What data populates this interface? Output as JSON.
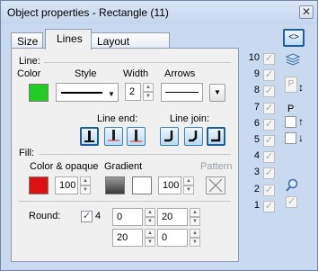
{
  "window": {
    "title": "Object properties - Rectangle (11)",
    "close_label": "✕"
  },
  "tabs": [
    {
      "label": "Size"
    },
    {
      "label": "Lines"
    },
    {
      "label": "Layout manager"
    }
  ],
  "line": {
    "section_label": "Line:",
    "color_label": "Color",
    "style_label": "Style",
    "width_label": "Width",
    "arrows_label": "Arrows",
    "color": "#22cc22",
    "width_value": "2",
    "line_end_label": "Line end:",
    "line_join_label": "Line join:"
  },
  "fill": {
    "section_label": "Fill:",
    "color_opaque_label": "Color & opaque",
    "gradient_label": "Gradient",
    "pattern_label": "Pattern",
    "color": "#dd1111",
    "opacity_value": "100",
    "gradient_opacity_value": "100"
  },
  "round": {
    "label": "Round:",
    "check_label": "4",
    "values": [
      "0",
      "20",
      "20",
      "0"
    ]
  },
  "side": {
    "toggle_label": "<>",
    "levels": [
      "10",
      "9",
      "8",
      "7",
      "6",
      "5",
      "4",
      "3",
      "2",
      "1"
    ],
    "p_label": "P",
    "p_label2": "P"
  }
}
